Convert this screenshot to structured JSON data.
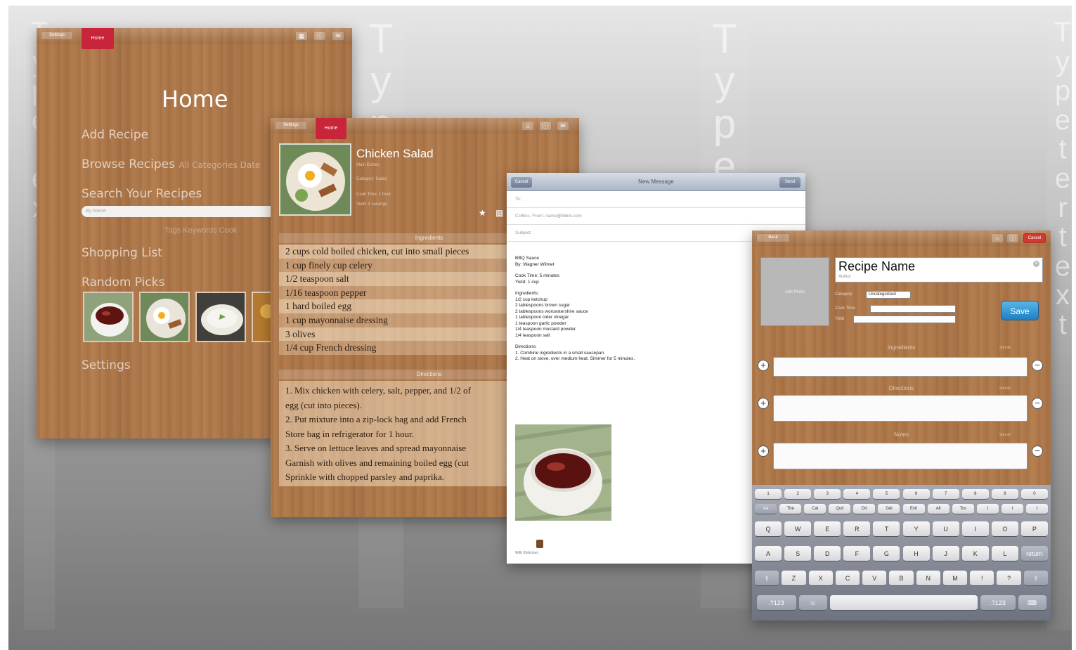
{
  "ghost": {
    "col1": [
      "T",
      "y",
      "p",
      "e",
      "",
      "t",
      "e",
      "x",
      "t"
    ],
    "col2": [
      "T",
      "y",
      "p",
      "e",
      "",
      "te",
      "xt"
    ],
    "col3": [
      "T",
      "y",
      "p",
      "e",
      "",
      "xt"
    ],
    "col4": [
      "T",
      "y",
      "p",
      "e",
      "t",
      "e",
      "r",
      "t",
      "e",
      "x",
      "t"
    ]
  },
  "home": {
    "pill_left": "Settings",
    "tab": "Home",
    "title": "Home",
    "menu": {
      "add": "Add Recipe",
      "browse": "Browse Recipes",
      "browse_opts": "All   Categories   Date",
      "search": "Search Your Recipes",
      "search_placeholder": "By Name",
      "search_opts": "Tags   Keywords   Cook",
      "shopping": "Shopping List",
      "random": "Random Picks",
      "settings": "Settings"
    }
  },
  "recipe": {
    "pill_left": "Settings",
    "tab": "Home",
    "title": "Chicken Salad",
    "meta": [
      "Main Dishes",
      "Category: Salad",
      "Cook Time: 1 hour",
      "Yield: 4 servings"
    ],
    "ingredients_header": "Ingredients",
    "ingredients": [
      "2 cups cold boiled chicken, cut into small pieces",
      "1 cup finely cup celery",
      "1/2 teaspoon salt",
      "1/16 teaspoon pepper",
      "1 hard boiled egg",
      "1 cup mayonnaise dressing",
      "3 olives",
      "1/4 cup French dressing"
    ],
    "directions_header": "Directions",
    "directions": [
      "1. Mix chicken with celery, salt, pepper, and 1/2 of",
      "egg (cut into pieces).",
      "2. Put mixture into a zip-lock bag and add French",
      "Store bag in refrigerator for 1 hour.",
      "3. Serve on lettuce leaves and spread mayonnaise",
      "Garnish with olives and remaining boiled egg (cut",
      "Sprinkle with chopped parsley and paprika."
    ]
  },
  "mail": {
    "cancel": "Cancel",
    "title": "New Message",
    "send": "Send",
    "to": "To:",
    "ccbcc": "Cc/Bcc, From: name@iblink.com",
    "subject": "Subject:",
    "body": [
      "BBQ Sauce",
      "By: Wagner Wilmet",
      "",
      "Cook Time: 5 minutes",
      "Yield: 1 cup",
      "",
      "Ingredients:",
      "1/2 cup ketchup",
      "2 tablespoons brown sugar",
      "2 tablespoons worcestershire sauce",
      "1 tablespoon cider vinegar",
      "1 teaspoon garlic powder",
      "1/4 teaspoon mustard powder",
      "1/4 teaspoon salt",
      "",
      "Directions:",
      "1. Combine ingredients in a small saucepan.",
      "2. Heat on stove, over medium heat. Simmer for 5 minutes."
    ],
    "signature": "With iDelicious"
  },
  "add": {
    "pill_left": "Back",
    "cancel": "Cancel",
    "photo_label": "Add Photo",
    "recipe_name": "Recipe Name",
    "author": "Author",
    "category_label": "Category",
    "category_value": "Uncategorized",
    "cook_time_label": "Cook Time",
    "yield_label": "Yield",
    "save": "Save",
    "ingredients": "Ingredients",
    "directions": "Directions",
    "notes": "Notes",
    "sec_right": "Sort all"
  },
  "keyboard": {
    "row0": [
      "1",
      "2",
      "3",
      "4",
      "5",
      "6",
      "7",
      "8",
      "9",
      "0"
    ],
    "row1": [
      "Aa",
      "The",
      "Cat",
      "Quit",
      "Drt",
      "Gel",
      "Exit",
      "All",
      "Tos",
      "I",
      "I",
      "I"
    ],
    "row2": [
      "Q",
      "W",
      "E",
      "R",
      "T",
      "Y",
      "U",
      "I",
      "O",
      "P"
    ],
    "row3": [
      "A",
      "S",
      "D",
      "F",
      "G",
      "H",
      "J",
      "K",
      "L",
      "return"
    ],
    "row4": [
      "⇧",
      "Z",
      "X",
      "C",
      "V",
      "B",
      "N",
      "M",
      "!",
      "?",
      "⇧"
    ],
    "row5": [
      ".?123",
      "☺",
      "",
      ".?123",
      "⌨"
    ]
  }
}
